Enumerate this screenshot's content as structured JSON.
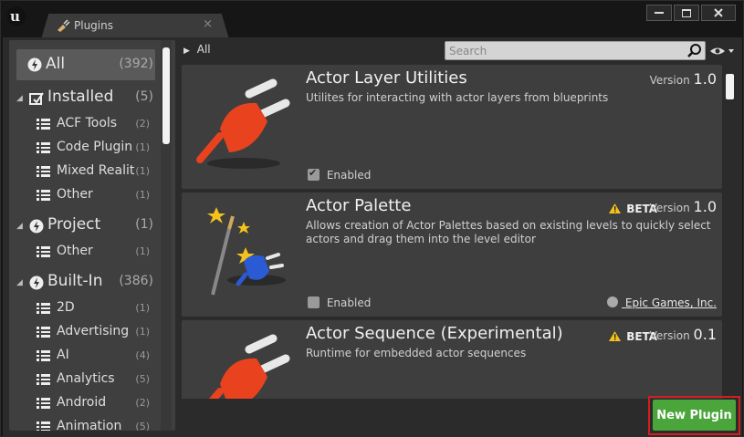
{
  "tab": {
    "title": "Plugins",
    "close": "×"
  },
  "window_controls": {
    "minimize": "▬",
    "maximize": "▭",
    "close": "✕"
  },
  "breadcrumb": {
    "arrow": "▶",
    "label": "All"
  },
  "search": {
    "placeholder": "Search",
    "value": ""
  },
  "sidebar": {
    "all": {
      "label": "All",
      "count": "(392)"
    },
    "installed": {
      "label": "Installed",
      "count": "(5)",
      "items": [
        {
          "label": "ACF Tools",
          "count": "(2)"
        },
        {
          "label": "Code Plugin",
          "count": "(1)"
        },
        {
          "label": "Mixed Realit",
          "count": "(1)"
        },
        {
          "label": "Other",
          "count": "(1)"
        }
      ]
    },
    "project": {
      "label": "Project",
      "count": "(1)",
      "items": [
        {
          "label": "Other",
          "count": "(1)"
        }
      ]
    },
    "builtin": {
      "label": "Built-In",
      "count": "(386)",
      "items": [
        {
          "label": "2D",
          "count": "(1)"
        },
        {
          "label": "Advertising",
          "count": "(1)"
        },
        {
          "label": "AI",
          "count": "(4)"
        },
        {
          "label": "Analytics",
          "count": "(5)"
        },
        {
          "label": "Android",
          "count": "(2)"
        },
        {
          "label": "Animation",
          "count": "(5)"
        }
      ]
    }
  },
  "plugins": [
    {
      "title": "Actor Layer Utilities",
      "description": "Utilites for interacting with actor layers from blueprints",
      "version_label": "Version",
      "version": "1.0",
      "beta": "",
      "enabled_label": "Enabled",
      "enabled": true,
      "author": ""
    },
    {
      "title": "Actor Palette",
      "description": "Allows creation of Actor Palettes based on existing levels to quickly select actors and drag them into the level editor",
      "version_label": "Version",
      "version": "1.0",
      "beta": "BETA",
      "enabled_label": "Enabled",
      "enabled": false,
      "author": "Epic Games, Inc."
    },
    {
      "title": "Actor Sequence (Experimental)",
      "description": "Runtime for embedded actor sequences",
      "version_label": "Version",
      "version": "0.1",
      "beta": "BETA",
      "enabled_label": "Enabled",
      "enabled": false,
      "author": ""
    }
  ],
  "new_plugin": {
    "label": "New Plugin"
  },
  "colors": {
    "accent_green": "#4aa53b",
    "highlight_red": "#d41d1d",
    "plug_orange": "#e8431e"
  }
}
